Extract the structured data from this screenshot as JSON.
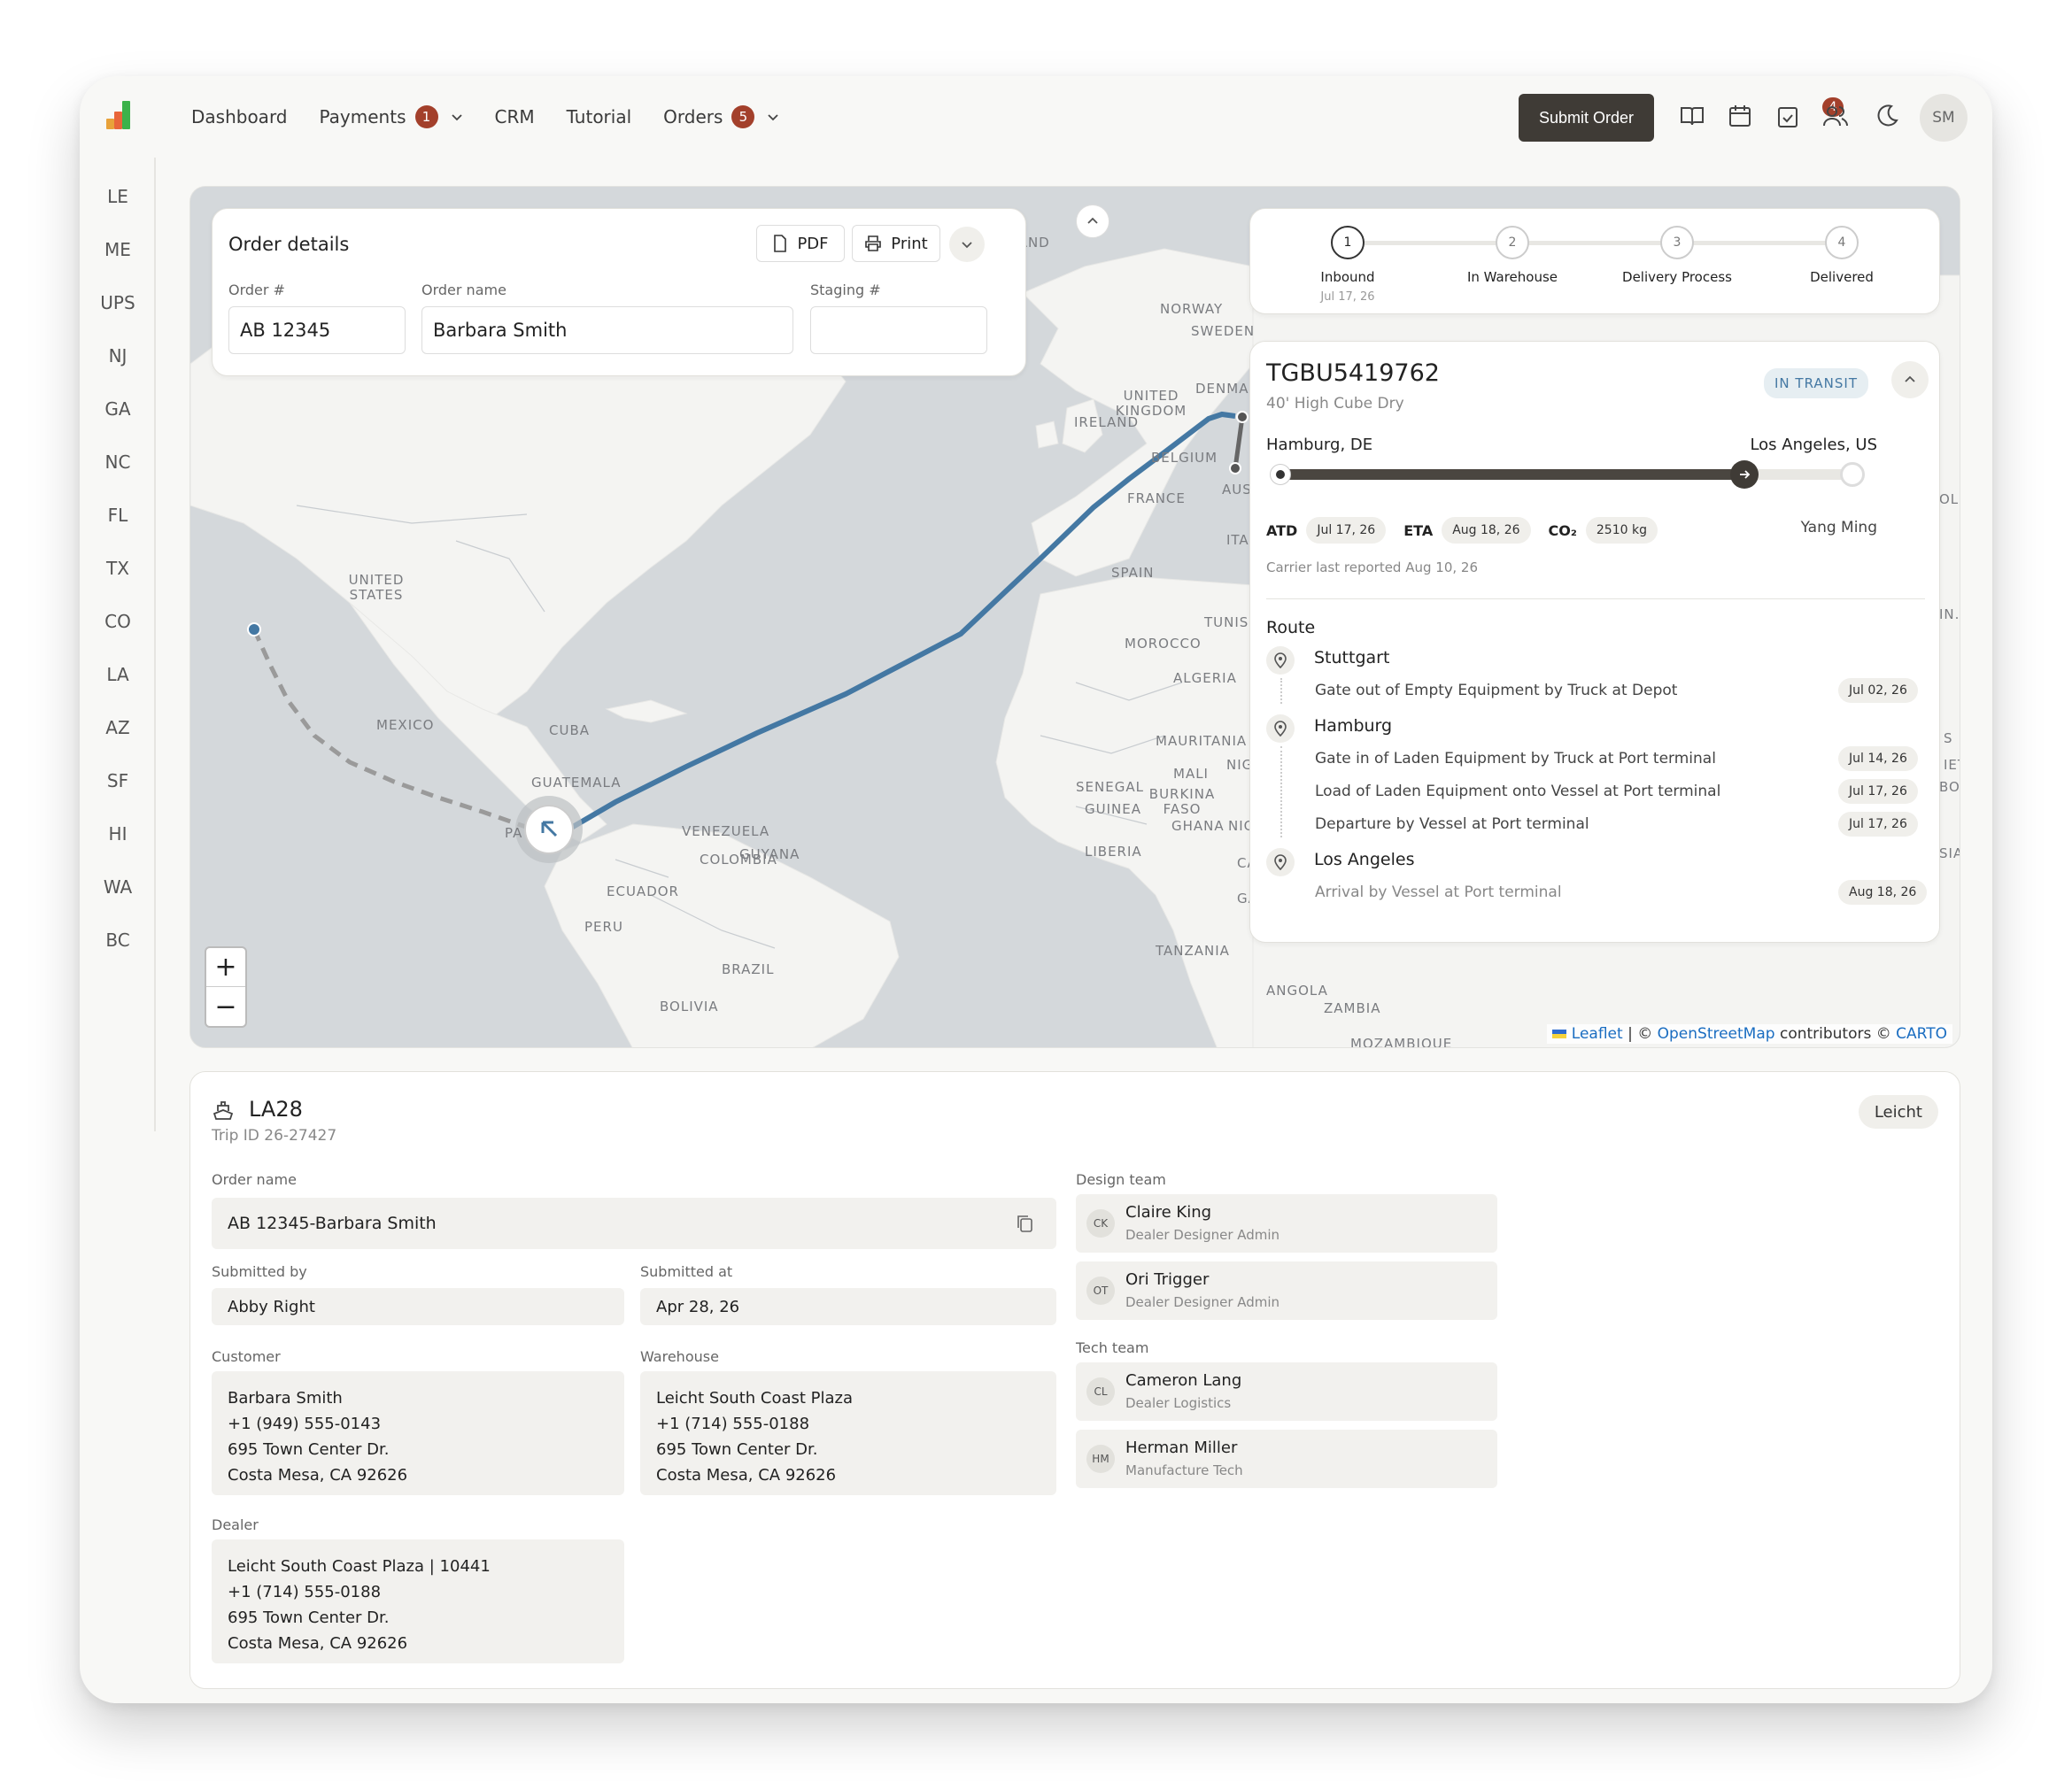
{
  "nav": {
    "items": [
      {
        "label": "Dashboard"
      },
      {
        "label": "Payments",
        "badge": "1"
      },
      {
        "label": "CRM"
      },
      {
        "label": "Tutorial"
      },
      {
        "label": "Orders",
        "badge": "5"
      }
    ],
    "submit_label": "Submit Order",
    "notify_badge": "4",
    "avatar": "SM"
  },
  "sidebar": [
    "LE",
    "ME",
    "UPS",
    "NJ",
    "GA",
    "NC",
    "FL",
    "TX",
    "CO",
    "LA",
    "AZ",
    "SF",
    "HI",
    "WA",
    "BC"
  ],
  "order": {
    "title": "Order details",
    "pdf": "PDF",
    "print": "Print",
    "num_label": "Order #",
    "num": "AB 12345",
    "name_label": "Order name",
    "name": "Barbara Smith",
    "staging_label": "Staging #",
    "staging": ""
  },
  "steps": [
    {
      "n": "1",
      "label": "Inbound",
      "date": "Jul 17, 26"
    },
    {
      "n": "2",
      "label": "In Warehouse"
    },
    {
      "n": "3",
      "label": "Delivery Process"
    },
    {
      "n": "4",
      "label": "Delivered"
    }
  ],
  "shipment": {
    "id": "TGBU5419762",
    "type": "40' High Cube Dry",
    "status": "IN TRANSIT",
    "from": "Hamburg, DE",
    "to": "Los Angeles, US",
    "atd_label": "ATD",
    "atd": "Jul 17, 26",
    "eta_label": "ETA",
    "eta": "Aug 18, 26",
    "co2_label": "CO₂",
    "co2": "2510 kg",
    "carrier": "Yang Ming",
    "reported": "Carrier last reported Aug 10, 26",
    "progress": 0.82,
    "route_title": "Route"
  },
  "route": [
    {
      "city": "Stuttgart",
      "events": [
        {
          "text": "Gate out of Empty Equipment by Truck at Depot",
          "date": "Jul 02, 26"
        }
      ]
    },
    {
      "city": "Hamburg",
      "events": [
        {
          "text": "Gate in of Laden Equipment by Truck at Port terminal",
          "date": "Jul 14, 26"
        },
        {
          "text": "Load of Laden Equipment onto Vessel at Port terminal",
          "date": "Jul 17, 26"
        },
        {
          "text": "Departure by Vessel at Port terminal",
          "date": "Jul 17, 26"
        }
      ]
    },
    {
      "city": "Los Angeles",
      "events": [
        {
          "text": "Arrival by Vessel at Port terminal",
          "date": "Aug 18, 26"
        }
      ]
    }
  ],
  "map": {
    "labels": [
      "LAND",
      "NORWAY",
      "SWEDEN",
      "DENMAR",
      "UNITED KINGDOM",
      "IRELAND",
      "BELGIUM",
      "FRANCE",
      "AUS",
      "ITA",
      "SPAIN",
      "TUNISIA",
      "MOROCCO",
      "ALGERIA",
      "MAURITANIA",
      "MALI",
      "NIGER",
      "SENEGAL",
      "BURKINA FASO",
      "GUINEA",
      "GHANA",
      "NIGERIA",
      "LIBERIA",
      "CAME",
      "GABO",
      "TANZANIA",
      "ANGOLA",
      "ZAMBIA",
      "MOZAMBIQUE",
      "UNITED STATES",
      "MEXICO",
      "CUBA",
      "GUATEMALA",
      "PA",
      "VENEZUELA",
      "COLOMBIA",
      "GUYANA",
      "ECUADOR",
      "PERU",
      "BRAZIL",
      "BOLIVIA",
      "OL",
      "IN.",
      "S",
      "IET",
      "BOI",
      "SIA"
    ],
    "zoom_in": "+",
    "zoom_out": "−",
    "attr_leaflet": "Leaflet",
    "attr_sep": " | © ",
    "attr_osm": "OpenStreetMap",
    "attr_mid": " contributors © ",
    "attr_carto": "CARTO"
  },
  "trip": {
    "name": "LA28",
    "id": "Trip ID 26-27427",
    "brand": "Leicht",
    "order_name_label": "Order name",
    "order_name": "AB 12345-Barbara Smith",
    "submitted_by_label": "Submitted by",
    "submitted_by": "Abby Right",
    "submitted_at_label": "Submitted at",
    "submitted_at": "Apr 28, 26",
    "customer_label": "Customer",
    "customer": [
      "Barbara Smith",
      "+1 (949) 555-0143",
      "695 Town Center Dr.",
      "Costa Mesa, CA 92626"
    ],
    "warehouse_label": "Warehouse",
    "warehouse": [
      "Leicht South Coast Plaza",
      "+1 (714) 555-0188",
      "695 Town Center Dr.",
      "Costa Mesa, CA 92626"
    ],
    "dealer_label": "Dealer",
    "dealer": [
      "Leicht South Coast Plaza | 10441",
      "+1 (714) 555-0188",
      "695 Town Center Dr.",
      "Costa Mesa, CA 92626"
    ],
    "design_label": "Design team",
    "design": [
      {
        "init": "CK",
        "name": "Claire King",
        "role": "Dealer Designer Admin"
      },
      {
        "init": "OT",
        "name": "Ori Trigger",
        "role": "Dealer Designer Admin"
      }
    ],
    "tech_label": "Tech team",
    "tech": [
      {
        "init": "CL",
        "name": "Cameron Lang",
        "role": "Dealer Logistics"
      },
      {
        "init": "HM",
        "name": "Herman Miller",
        "role": "Manufacture Tech"
      }
    ]
  },
  "colors": {
    "route": "#4478a3",
    "accent": "#a3402b",
    "dark": "#3f3b36"
  }
}
